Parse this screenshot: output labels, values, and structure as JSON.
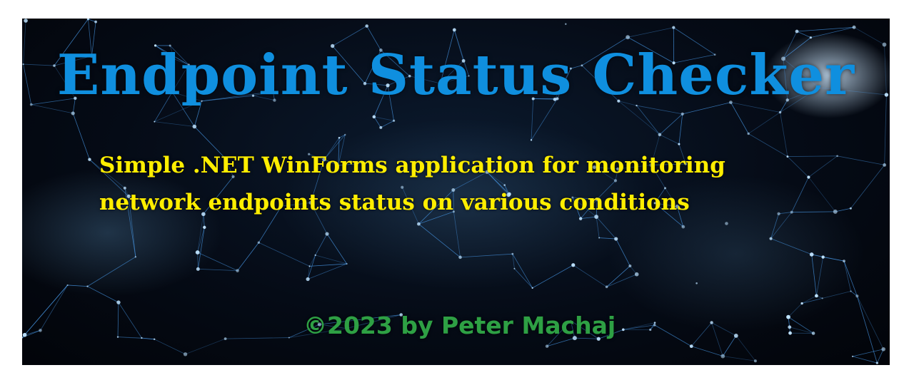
{
  "banner": {
    "title": "Endpoint Status Checker",
    "subtitle_line1": "Simple .NET WinForms application for monitoring",
    "subtitle_line2": "network endpoints status on various conditions",
    "credit": "©2023 by Peter Machaj",
    "background": "network-mesh-image"
  },
  "colors": {
    "title": "#0f8fdf",
    "subtitle": "#ffee00",
    "credit": "#2ea044",
    "background": "#050b16",
    "network_lines": "#4fa8ff"
  }
}
